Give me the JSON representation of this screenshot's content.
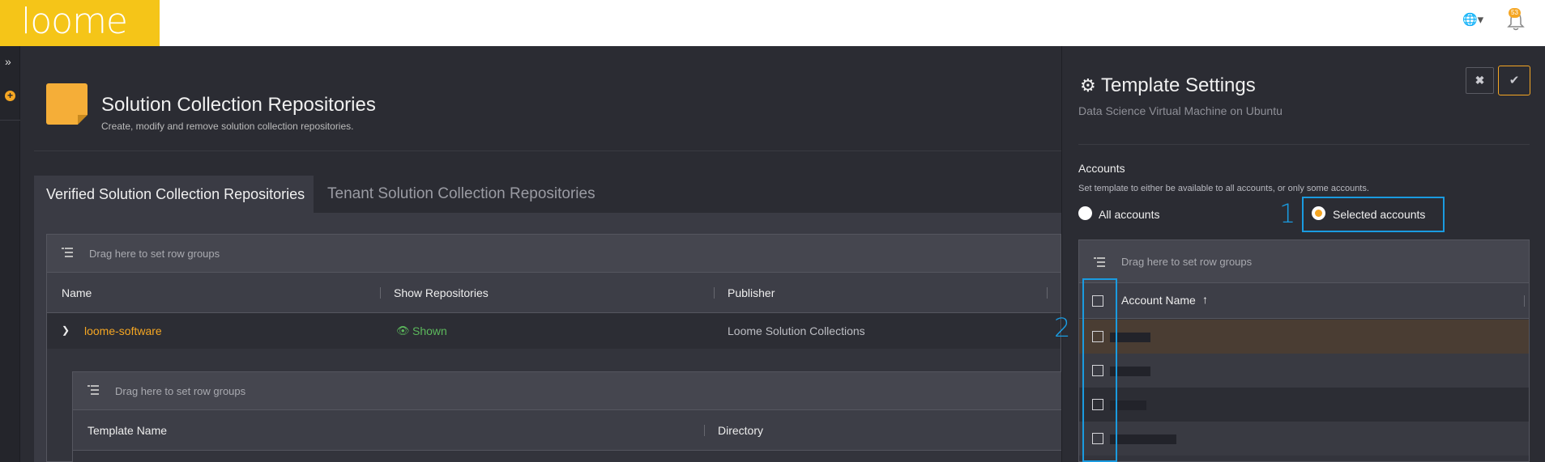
{
  "topbar": {
    "logo": "loome",
    "notification_count": "53"
  },
  "main": {
    "page_title": "Solution Collection Repositories",
    "page_subtitle": "Create, modify and remove solution collection repositories.",
    "tabs": [
      {
        "label": "Verified Solution Collection Repositories",
        "active": true
      },
      {
        "label": "Tenant Solution Collection Repositories",
        "active": false
      }
    ],
    "grid": {
      "group_hint": "Drag here to set row groups",
      "columns": [
        "Name",
        "Show Repositories",
        "Publisher"
      ],
      "rows": [
        {
          "name": "loome-software",
          "show_repositories": "Shown",
          "publisher": "Loome Solution Collections"
        }
      ]
    },
    "subgrid": {
      "group_hint": "Drag here to set row groups",
      "columns": [
        "Template Name",
        "Directory"
      ]
    }
  },
  "panel": {
    "title": "Template Settings",
    "subtitle": "Data Science Virtual Machine on Ubuntu",
    "accounts_label": "Accounts",
    "accounts_help": "Set template to either be available to all accounts, or only some accounts.",
    "options": [
      {
        "label": "All accounts",
        "selected": false
      },
      {
        "label": "Selected accounts",
        "selected": true
      }
    ],
    "grid": {
      "group_hint": "Drag here to set row groups",
      "column": "Account Name",
      "row_count": 4
    },
    "callouts": [
      "1",
      "2"
    ]
  },
  "colors": {
    "accent": "#f5a623",
    "callout": "#1a9be0",
    "brand": "#f5c518",
    "success": "#5cb85c"
  },
  "icons": [
    "globe-icon",
    "bell-icon",
    "expand-icon",
    "add-icon",
    "gear-icon",
    "close-icon",
    "check-icon",
    "row-group-icon",
    "eye-icon",
    "chevron-down-icon",
    "sort-asc-icon"
  ]
}
